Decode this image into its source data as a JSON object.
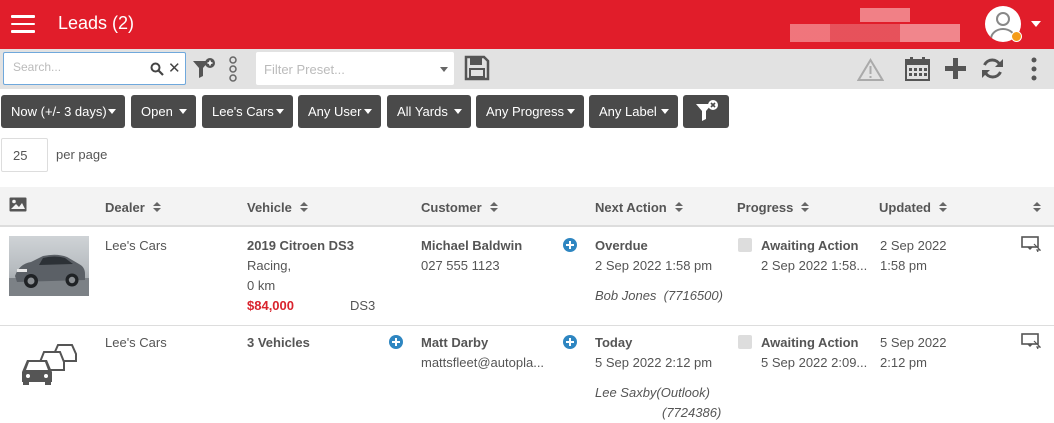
{
  "header": {
    "title": "Leads (2)"
  },
  "toolbar": {
    "search_placeholder": "Search...",
    "preset_placeholder": "Filter Preset..."
  },
  "filters": [
    {
      "label": "Now (+/- 3 days)"
    },
    {
      "label": "Open"
    },
    {
      "label": "Lee's Cars"
    },
    {
      "label": "Any User"
    },
    {
      "label": "All Yards"
    },
    {
      "label": "Any Progress"
    },
    {
      "label": "Any Label"
    }
  ],
  "paging": {
    "per_page_value": "25",
    "per_page_label": "per page"
  },
  "columns": {
    "dealer": "Dealer",
    "vehicle": "Vehicle",
    "customer": "Customer",
    "next_action": "Next Action",
    "progress": "Progress",
    "updated": "Updated"
  },
  "rows": [
    {
      "dealer": "Lee's Cars",
      "vehicle_title": "2019 Citroen DS3",
      "vehicle_line2": "Racing,",
      "vehicle_line3": "0 km",
      "price": "$84,000",
      "model": "DS3",
      "customer_name": "Michael Baldwin",
      "customer_contact": "027 555 1123",
      "next_action": "Overdue",
      "next_action_date": "2 Sep 2022 1:58 pm",
      "assignee": "Bob Jones",
      "assignee_id": "(7716500)",
      "progress": "Awaiting Action",
      "progress_date": "2 Sep 2022 1:58...",
      "updated_date": "2 Sep 2022",
      "updated_time": "1:58 pm"
    },
    {
      "dealer": "Lee's Cars",
      "vehicle_title": "3 Vehicles",
      "customer_name": "Matt Darby",
      "customer_contact": "mattsfleet@autopla...",
      "next_action": "Today",
      "next_action_date": "5 Sep 2022 2:12 pm",
      "assignee": "Lee Saxby(Outlook)",
      "assignee_id": "(7724386)",
      "progress": "Awaiting Action",
      "progress_date": "5 Sep 2022 2:09...",
      "updated_date": "5 Sep 2022",
      "updated_time": "2:12 pm"
    }
  ],
  "colors": {
    "brand": "#e11d2a",
    "filter_button": "#4a4a4a",
    "price": "#d9232d",
    "add": "#2e86c1"
  }
}
